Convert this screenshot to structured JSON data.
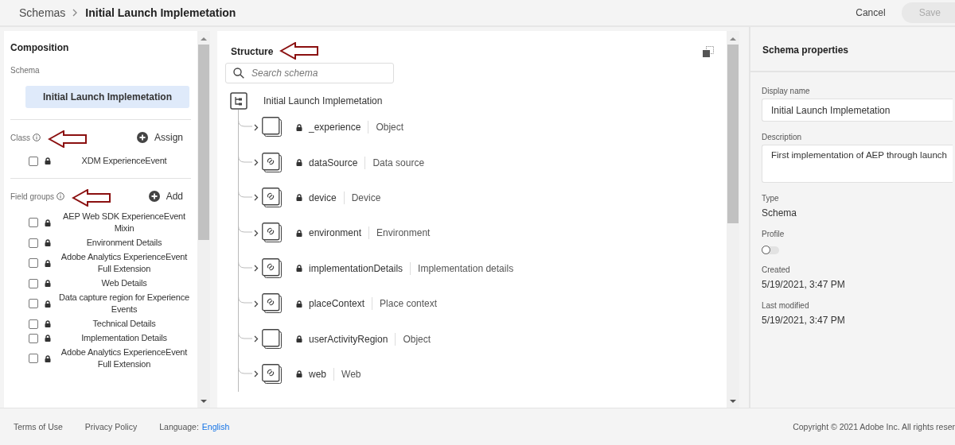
{
  "header": {
    "breadcrumb": "Schemas",
    "title": "Initial Launch Implemetation",
    "cancel": "Cancel",
    "save": {
      "label": "Save",
      "disabled": true
    }
  },
  "composition": {
    "title": "Composition",
    "schema_label": "Schema",
    "schema_name": "Initial Launch Implemetation",
    "class_label": "Class",
    "assign": "Assign",
    "classes": [
      {
        "name": "XDM ExperienceEvent",
        "checked": false
      }
    ],
    "field_groups_label": "Field groups",
    "add": "Add",
    "field_groups": [
      {
        "name": "AEP Web SDK ExperienceEvent Mixin",
        "checked": false
      },
      {
        "name": "Environment Details",
        "checked": false
      },
      {
        "name": "Adobe Analytics ExperienceEvent Full Extension",
        "checked": false
      },
      {
        "name": "Web Details",
        "checked": false
      },
      {
        "name": "Data capture region for Experience Events",
        "checked": false
      },
      {
        "name": "Technical Details",
        "checked": false
      },
      {
        "name": "Implementation Details",
        "checked": false
      },
      {
        "name": "Adobe Analytics ExperienceEvent Full Extension",
        "checked": false
      }
    ]
  },
  "structure": {
    "title": "Structure",
    "search": {
      "placeholder": "Search schema"
    },
    "root": "Initial Launch Implemetation",
    "fields": [
      {
        "kind": "object",
        "name": "_experience",
        "type": "Object"
      },
      {
        "kind": "link",
        "name": "dataSource",
        "type": "Data source"
      },
      {
        "kind": "link",
        "name": "device",
        "type": "Device"
      },
      {
        "kind": "link",
        "name": "environment",
        "type": "Environment"
      },
      {
        "kind": "link",
        "name": "implementationDetails",
        "type": "Implementation details"
      },
      {
        "kind": "link",
        "name": "placeContext",
        "type": "Place context"
      },
      {
        "kind": "object",
        "name": "userActivityRegion",
        "type": "Object"
      },
      {
        "kind": "link",
        "name": "web",
        "type": "Web"
      }
    ]
  },
  "properties": {
    "title": "Schema properties",
    "display_name_label": "Display name",
    "display_name": "Initial Launch Implemetation",
    "description_label": "Description",
    "description": "First implementation of AEP through launch",
    "type_label": "Type",
    "type": "Schema",
    "profile_label": "Profile",
    "profile_on": false,
    "created_label": "Created",
    "created": "5/19/2021, 3:47 PM",
    "modified_label": "Last modified",
    "modified": "5/19/2021, 3:47 PM"
  },
  "footer": {
    "terms": "Terms of Use",
    "privacy": "Privacy Policy",
    "language_label": "Language:",
    "language": "English",
    "copyright": "Copyright © 2021 Adobe Inc. All rights reser"
  }
}
